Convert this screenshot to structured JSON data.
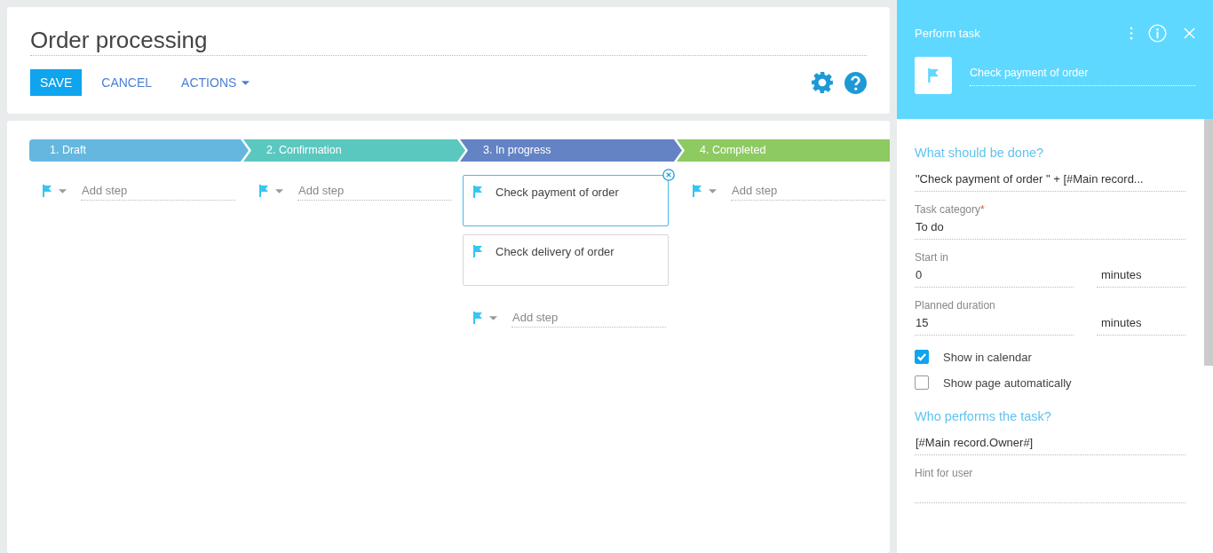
{
  "header": {
    "title": "Order processing",
    "buttons": [
      {
        "label": "SAVE",
        "kind": "primary"
      },
      {
        "label": "CANCEL",
        "kind": "link"
      },
      {
        "label": "ACTIONS",
        "kind": "menu"
      }
    ]
  },
  "stages": [
    {
      "label": "1. Draft",
      "color": "#65b7df",
      "placeholder": "Add step"
    },
    {
      "label": "2. Confirmation",
      "color": "#5bc8c0",
      "placeholder": "Add step"
    },
    {
      "label": "3. In progress",
      "color": "#6383c5",
      "placeholder": "Add step",
      "steps": [
        {
          "title": "Check payment of order",
          "selected": true
        },
        {
          "title": "Check delivery of order",
          "selected": false
        }
      ]
    },
    {
      "label": "4. Completed",
      "color": "#8dca62",
      "placeholder": "Add step"
    }
  ],
  "panel": {
    "title": "Perform task",
    "task_name": "Check payment of order",
    "items": [
      {
        "kind": "heading",
        "text": "What should be done?"
      },
      {
        "kind": "value",
        "value": "\"Check payment of order \" + [#Main record..."
      },
      {
        "kind": "field",
        "label": "Task category",
        "required_mark": "*",
        "value": "To do"
      },
      {
        "kind": "pair",
        "label": "Start in",
        "value": "0",
        "unit": "minutes"
      },
      {
        "kind": "pair",
        "label": "Planned duration",
        "value": "15",
        "unit": "minutes"
      },
      {
        "kind": "checkbox",
        "label": "Show in calendar",
        "checked": true
      },
      {
        "kind": "checkbox",
        "label": "Show page automatically",
        "checked": false
      },
      {
        "kind": "heading",
        "text": "Who performs the task?"
      },
      {
        "kind": "value",
        "value": "[#Main record.Owner#]"
      },
      {
        "kind": "field",
        "label": "Hint for user"
      }
    ]
  }
}
